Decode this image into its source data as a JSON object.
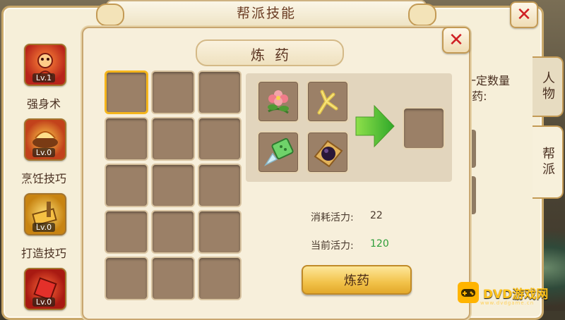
{
  "window": {
    "title": "帮派技能",
    "close_icon": "close-icon"
  },
  "skills": [
    {
      "name": "强身术",
      "level": "Lv.1",
      "icon": "strength-icon",
      "color": "#c0301e"
    },
    {
      "name": "烹饪技巧",
      "level": "Lv.0",
      "icon": "cooking-icon",
      "color": "#b4391b"
    },
    {
      "name": "打造技巧",
      "level": "Lv.0",
      "icon": "forging-icon",
      "color": "#d18a12"
    },
    {
      "name": "",
      "level": "Lv.0",
      "icon": "skill-icon",
      "color": "#c4261a"
    }
  ],
  "side_tabs": [
    {
      "label": "人物"
    },
    {
      "label": "帮派"
    }
  ],
  "background_hint": {
    "line1": "一定数量",
    "line2": "E药:"
  },
  "alchemy": {
    "title": "炼药",
    "ingredients": [
      {
        "icon": "flower-herb-icon"
      },
      {
        "icon": "branch-herb-icon"
      },
      {
        "icon": "jade-shard-icon"
      },
      {
        "icon": "dark-pill-icon"
      }
    ],
    "arrow_icon": "green-arrow-icon",
    "cost_label": "消耗活力:",
    "cost_value": "22",
    "current_label": "当前活力:",
    "current_value": "120",
    "current_value_color": "#2e9e3a",
    "craft_button": "炼药"
  },
  "watermark": {
    "text": "DVD游戏网",
    "sub": "www.dvdgame.cn"
  },
  "colors": {
    "accent_gold": "#f4b51c",
    "close_red": "#cf1f24"
  }
}
